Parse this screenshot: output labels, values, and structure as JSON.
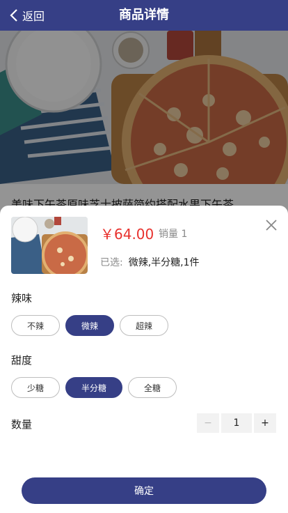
{
  "header": {
    "back_label": "返回",
    "title": "商品详情"
  },
  "product": {
    "title": "美味下午茶原味芝士披萨简约搭配水果下午茶"
  },
  "sheet": {
    "price": "￥64.00",
    "sales": "销量 1",
    "selected_label": "已选:",
    "selected_value": "微辣,半分糖,1件",
    "groups": [
      {
        "name": "辣味",
        "options": [
          "不辣",
          "微辣",
          "超辣"
        ],
        "selected": "微辣"
      },
      {
        "name": "甜度",
        "options": [
          "少糖",
          "半分糖",
          "全糖"
        ],
        "selected": "半分糖"
      }
    ],
    "quantity_label": "数量",
    "quantity": "1",
    "minus": "−",
    "plus": "+",
    "confirm": "确定"
  },
  "colors": {
    "primary": "#363f86",
    "price": "#e8312d"
  },
  "icons": {
    "back": "chevron-left-icon",
    "close": "close-icon"
  }
}
